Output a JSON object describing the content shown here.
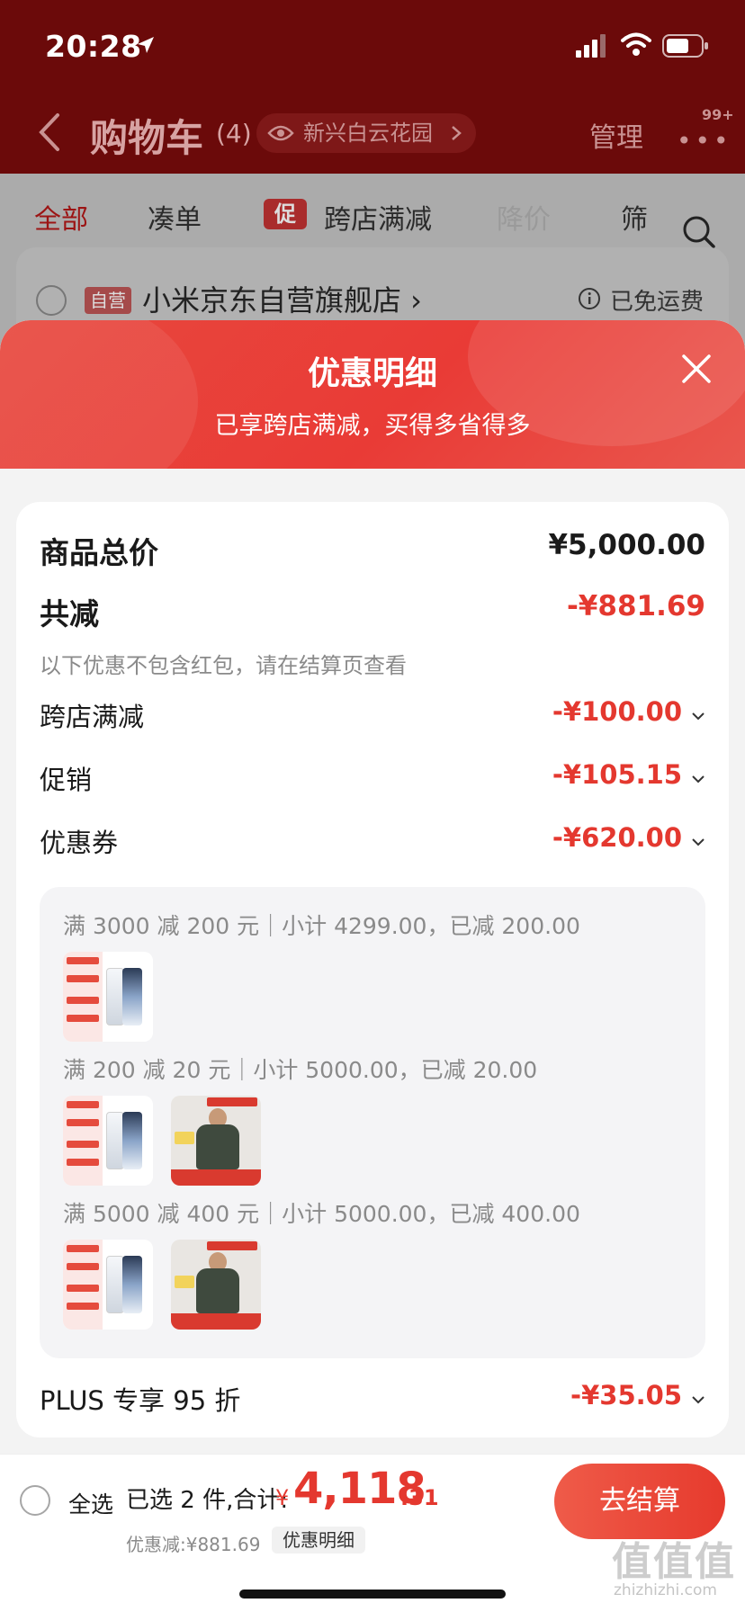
{
  "status_bar": {
    "time": "20:28"
  },
  "header": {
    "title": "购物车",
    "count": "(4)",
    "address": "新兴白云花园",
    "manage": "管理",
    "more": "•••",
    "badge": "99+"
  },
  "tabs": [
    {
      "label": "全部"
    },
    {
      "label": "凑单"
    },
    {
      "label": "跨店满减",
      "tag": "促"
    },
    {
      "label": "降价"
    },
    {
      "label": "筛"
    }
  ],
  "store": {
    "self_tag": "自营",
    "name": "小米京东自营旗舰店 ›",
    "shipping": "已免运费"
  },
  "sheet": {
    "title": "优惠明细",
    "subtitle": "已享跨店满减，买得多省得多",
    "total_label": "商品总价",
    "total_value": "¥5,000.00",
    "reduce_label": "共减",
    "reduce_value": "-¥881.69",
    "note": "以下优惠不包含红包，请在结算页查看",
    "items": [
      {
        "label": "跨店满减",
        "value": "-¥100.00"
      },
      {
        "label": "促销",
        "value": "-¥105.15"
      },
      {
        "label": "优惠券",
        "value": "-¥620.00"
      }
    ],
    "coupons": [
      {
        "text": "满 3000 减 200 元｜小计 4299.00，已减 200.00"
      },
      {
        "text": "满 200 减 20 元｜小计 5000.00，已减 20.00"
      },
      {
        "text": "满 5000 减 400 元｜小计 5000.00，已减 400.00"
      }
    ],
    "plus_label": "PLUS 专享 95 折",
    "plus_value": "-¥35.05"
  },
  "bottom": {
    "select_all": "全选",
    "selected": "已选 2 件,合计:",
    "currency": "¥",
    "total_int": "4,118",
    "total_dec": ".31",
    "saved": "优惠减:¥881.69",
    "detail": "优惠明细",
    "checkout": "去结算"
  },
  "watermark": {
    "logo": "值值值",
    "site": "zhizhizhi.com"
  },
  "colors": {
    "accent": "#e4382f",
    "header_bg": "#6b0a0a"
  }
}
